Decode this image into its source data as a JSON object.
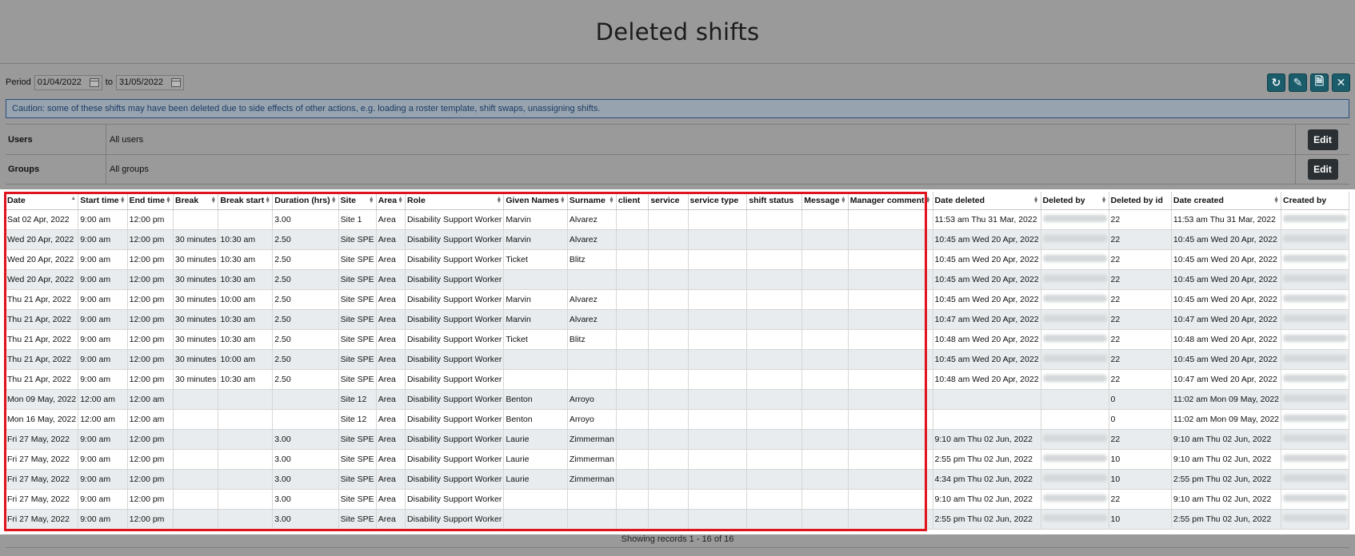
{
  "page": {
    "title": "Deleted shifts"
  },
  "period": {
    "label": "Period",
    "from": "01/04/2022",
    "to_label": "to",
    "to": "31/05/2022"
  },
  "toolbar": {
    "icons": [
      "refresh-icon",
      "edit-icon",
      "pdf-icon",
      "excel-icon"
    ],
    "accent": "#1b5c6b"
  },
  "caution": "Caution: some of these shifts may have been deleted due to side effects of other actions, e.g. loading a roster template, shift swaps, unassigning shifts.",
  "filters": [
    {
      "label": "Users",
      "value": "All users",
      "button": "Edit"
    },
    {
      "label": "Groups",
      "value": "All groups",
      "button": "Edit"
    }
  ],
  "table": {
    "columns": [
      "Date",
      "Start time",
      "End time",
      "Break",
      "Break start",
      "Duration (hrs)",
      "Site",
      "Area",
      "Role",
      "Given Names",
      "Surname",
      "client",
      "service",
      "service type",
      "shift status",
      "Message",
      "Manager comment",
      "Date deleted",
      "Deleted by",
      "Deleted by id",
      "Date created",
      "Created by"
    ],
    "rows": [
      [
        "Sat 02 Apr, 2022",
        "9:00 am",
        "12:00 pm",
        "",
        "",
        "3.00",
        "Site 1",
        "Area",
        "Disability Support Worker",
        "Marvin",
        "Alvarez",
        "",
        "",
        "",
        "",
        "",
        "",
        "11:53 am Thu 31 Mar, 2022",
        "",
        "22",
        "11:53 am Thu 31 Mar, 2022",
        ""
      ],
      [
        "Wed 20 Apr, 2022",
        "9:00 am",
        "12:00 pm",
        "30 minutes",
        "10:30 am",
        "2.50",
        "Site SPE",
        "Area",
        "Disability Support Worker",
        "Marvin",
        "Alvarez",
        "",
        "",
        "",
        "",
        "",
        "",
        "10:45 am Wed 20 Apr, 2022",
        "",
        "22",
        "10:45 am Wed 20 Apr, 2022",
        ""
      ],
      [
        "Wed 20 Apr, 2022",
        "9:00 am",
        "12:00 pm",
        "30 minutes",
        "10:30 am",
        "2.50",
        "Site SPE",
        "Area",
        "Disability Support Worker",
        "Ticket",
        "Blitz",
        "",
        "",
        "",
        "",
        "",
        "",
        "10:45 am Wed 20 Apr, 2022",
        "",
        "22",
        "10:45 am Wed 20 Apr, 2022",
        ""
      ],
      [
        "Wed 20 Apr, 2022",
        "9:00 am",
        "12:00 pm",
        "30 minutes",
        "10:30 am",
        "2.50",
        "Site SPE",
        "Area",
        "Disability Support Worker",
        "",
        "",
        "",
        "",
        "",
        "",
        "",
        "",
        "10:45 am Wed 20 Apr, 2022",
        "",
        "22",
        "10:45 am Wed 20 Apr, 2022",
        ""
      ],
      [
        "Thu 21 Apr, 2022",
        "9:00 am",
        "12:00 pm",
        "30 minutes",
        "10:00 am",
        "2.50",
        "Site SPE",
        "Area",
        "Disability Support Worker",
        "Marvin",
        "Alvarez",
        "",
        "",
        "",
        "",
        "",
        "",
        "10:45 am Wed 20 Apr, 2022",
        "",
        "22",
        "10:45 am Wed 20 Apr, 2022",
        ""
      ],
      [
        "Thu 21 Apr, 2022",
        "9:00 am",
        "12:00 pm",
        "30 minutes",
        "10:30 am",
        "2.50",
        "Site SPE",
        "Area",
        "Disability Support Worker",
        "Marvin",
        "Alvarez",
        "",
        "",
        "",
        "",
        "",
        "",
        "10:47 am Wed 20 Apr, 2022",
        "",
        "22",
        "10:47 am Wed 20 Apr, 2022",
        ""
      ],
      [
        "Thu 21 Apr, 2022",
        "9:00 am",
        "12:00 pm",
        "30 minutes",
        "10:30 am",
        "2.50",
        "Site SPE",
        "Area",
        "Disability Support Worker",
        "Ticket",
        "Blitz",
        "",
        "",
        "",
        "",
        "",
        "",
        "10:48 am Wed 20 Apr, 2022",
        "",
        "22",
        "10:48 am Wed 20 Apr, 2022",
        ""
      ],
      [
        "Thu 21 Apr, 2022",
        "9:00 am",
        "12:00 pm",
        "30 minutes",
        "10:00 am",
        "2.50",
        "Site SPE",
        "Area",
        "Disability Support Worker",
        "",
        "",
        "",
        "",
        "",
        "",
        "",
        "",
        "10:45 am Wed 20 Apr, 2022",
        "",
        "22",
        "10:45 am Wed 20 Apr, 2022",
        ""
      ],
      [
        "Thu 21 Apr, 2022",
        "9:00 am",
        "12:00 pm",
        "30 minutes",
        "10:30 am",
        "2.50",
        "Site SPE",
        "Area",
        "Disability Support Worker",
        "",
        "",
        "",
        "",
        "",
        "",
        "",
        "",
        "10:48 am Wed 20 Apr, 2022",
        "",
        "22",
        "10:47 am Wed 20 Apr, 2022",
        ""
      ],
      [
        "Mon 09 May, 2022",
        "12:00 am",
        "12:00 am",
        "",
        "",
        "",
        "Site 12",
        "Area",
        "Disability Support Worker",
        "Benton",
        "Arroyo",
        "",
        "",
        "",
        "",
        "",
        "",
        "",
        "",
        "0",
        "11:02 am Mon 09 May, 2022",
        ""
      ],
      [
        "Mon 16 May, 2022",
        "12:00 am",
        "12:00 am",
        "",
        "",
        "",
        "Site 12",
        "Area",
        "Disability Support Worker",
        "Benton",
        "Arroyo",
        "",
        "",
        "",
        "",
        "",
        "",
        "",
        "",
        "0",
        "11:02 am Mon 09 May, 2022",
        ""
      ],
      [
        "Fri 27 May, 2022",
        "9:00 am",
        "12:00 pm",
        "",
        "",
        "3.00",
        "Site SPE",
        "Area",
        "Disability Support Worker",
        "Laurie",
        "Zimmerman",
        "",
        "",
        "",
        "",
        "",
        "",
        "9:10 am Thu 02 Jun, 2022",
        "",
        "22",
        "9:10 am Thu 02 Jun, 2022",
        ""
      ],
      [
        "Fri 27 May, 2022",
        "9:00 am",
        "12:00 pm",
        "",
        "",
        "3.00",
        "Site SPE",
        "Area",
        "Disability Support Worker",
        "Laurie",
        "Zimmerman",
        "",
        "",
        "",
        "",
        "",
        "",
        "2:55 pm Thu 02 Jun, 2022",
        "",
        "10",
        "9:10 am Thu 02 Jun, 2022",
        ""
      ],
      [
        "Fri 27 May, 2022",
        "9:00 am",
        "12:00 pm",
        "",
        "",
        "3.00",
        "Site SPE",
        "Area",
        "Disability Support Worker",
        "Laurie",
        "Zimmerman",
        "",
        "",
        "",
        "",
        "",
        "",
        "4:34 pm Thu 02 Jun, 2022",
        "",
        "10",
        "2:55 pm Thu 02 Jun, 2022",
        ""
      ],
      [
        "Fri 27 May, 2022",
        "9:00 am",
        "12:00 pm",
        "",
        "",
        "3.00",
        "Site SPE",
        "Area",
        "Disability Support Worker",
        "",
        "",
        "",
        "",
        "",
        "",
        "",
        "",
        "9:10 am Thu 02 Jun, 2022",
        "",
        "22",
        "9:10 am Thu 02 Jun, 2022",
        ""
      ],
      [
        "Fri 27 May, 2022",
        "9:00 am",
        "12:00 pm",
        "",
        "",
        "3.00",
        "Site SPE",
        "Area",
        "Disability Support Worker",
        "",
        "",
        "",
        "",
        "",
        "",
        "",
        "",
        "2:55 pm Thu 02 Jun, 2022",
        "",
        "10",
        "2:55 pm Thu 02 Jun, 2022",
        ""
      ]
    ]
  },
  "footer": "Showing records 1 - 16 of 16"
}
